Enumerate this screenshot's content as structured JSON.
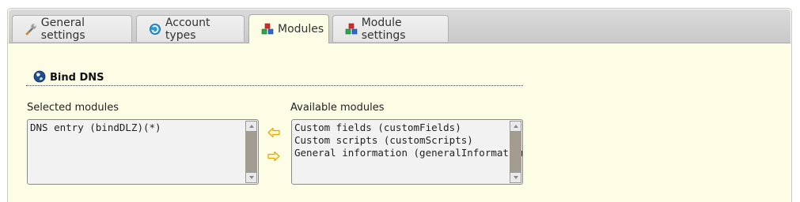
{
  "tabs": [
    {
      "label": "General settings",
      "icon": "wrench-icon"
    },
    {
      "label": "Account types",
      "icon": "gear-icon"
    },
    {
      "label": "Modules",
      "icon": "modules-icon",
      "active": true
    },
    {
      "label": "Module settings",
      "icon": "modules-icon"
    }
  ],
  "section": {
    "title": "Bind DNS",
    "icon": "globe-icon"
  },
  "selected": {
    "label": "Selected modules",
    "items": [
      "DNS entry (bindDLZ)(*)"
    ]
  },
  "available": {
    "label": "Available modules",
    "items": [
      "Custom fields (customFields)",
      "Custom scripts (customScripts)",
      "General information (generalInformation)"
    ]
  },
  "buttons": {
    "move_left": "arrow-left-icon",
    "move_right": "arrow-right-icon"
  },
  "colors": {
    "panel": "#fdfde6",
    "tabbar": "#cfcfcf",
    "scroll_track": "#a39c91",
    "arrow": "#e8b000"
  }
}
